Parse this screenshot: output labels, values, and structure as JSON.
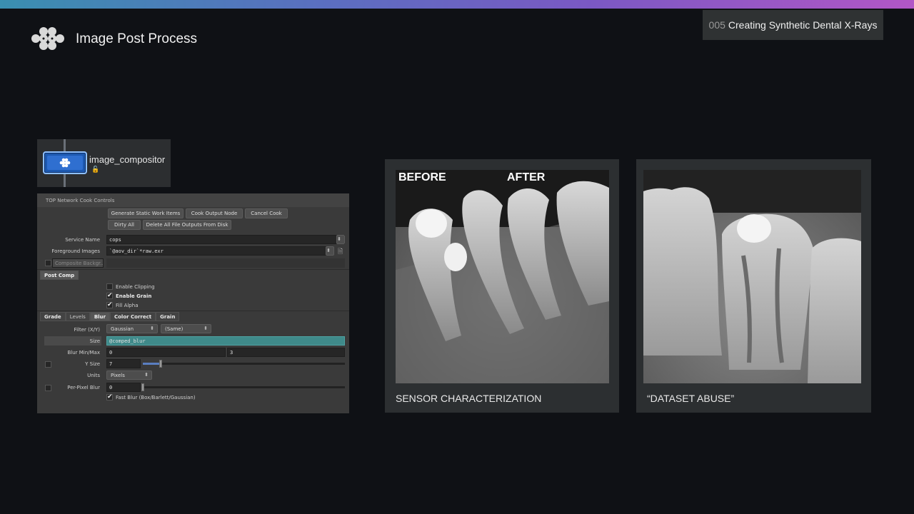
{
  "slide": {
    "title": "Image Post Process",
    "tag_number": "005",
    "tag_text": "Creating Synthetic Dental X-Rays",
    "accent_colors": [
      "#3a8fb0",
      "#7b58c4",
      "#b257c6"
    ]
  },
  "node": {
    "label": "image_compositor",
    "color": "#1d59b0"
  },
  "panel": {
    "header": "TOP Network Cook Controls",
    "buttons": {
      "generate": "Generate Static Work Items",
      "cook_output": "Cook Output Node",
      "cancel_cook": "Cancel Cook",
      "dirty_all": "Dirty All",
      "delete_outputs": "Delete All File Outputs From Disk"
    },
    "service_name_label": "Service Name",
    "service_name_value": "cops",
    "fg_images_label": "Foreground Images",
    "fg_images_value": "`@aov_dir`*raw.exr",
    "composite_bg_label": "Composite Backgr...",
    "section_tab": "Post Comp",
    "enable_clipping": "Enable Clipping",
    "enable_grain": "Enable Grain",
    "fill_alpha": "Fill Alpha",
    "tabs": [
      "Grade",
      "Levels",
      "Blur",
      "Color Correct",
      "Grain"
    ],
    "filter_label": "Filter (X/Y)",
    "filter_x": "Gaussian",
    "filter_y": "(Same)",
    "size_label": "Size",
    "size_value": "@comped_blur",
    "blur_minmax_label": "Blur Min/Max",
    "blur_min": "0",
    "blur_max": "3",
    "ysize_label": "Y Size",
    "ysize_value": "7",
    "ysize_fraction": 0.09,
    "units_label": "Units",
    "units_value": "Pixels",
    "per_pixel_label": "Per-Pixel Blur",
    "per_pixel_value": "0",
    "fast_blur": "Fast Blur (Box/Barlett/Gaussian)"
  },
  "cards": {
    "left_caption": "SENSOR CHARACTERIZATION",
    "before_label": "BEFORE",
    "after_label": "AFTER",
    "right_caption": "“DATASET ABUSE”"
  }
}
